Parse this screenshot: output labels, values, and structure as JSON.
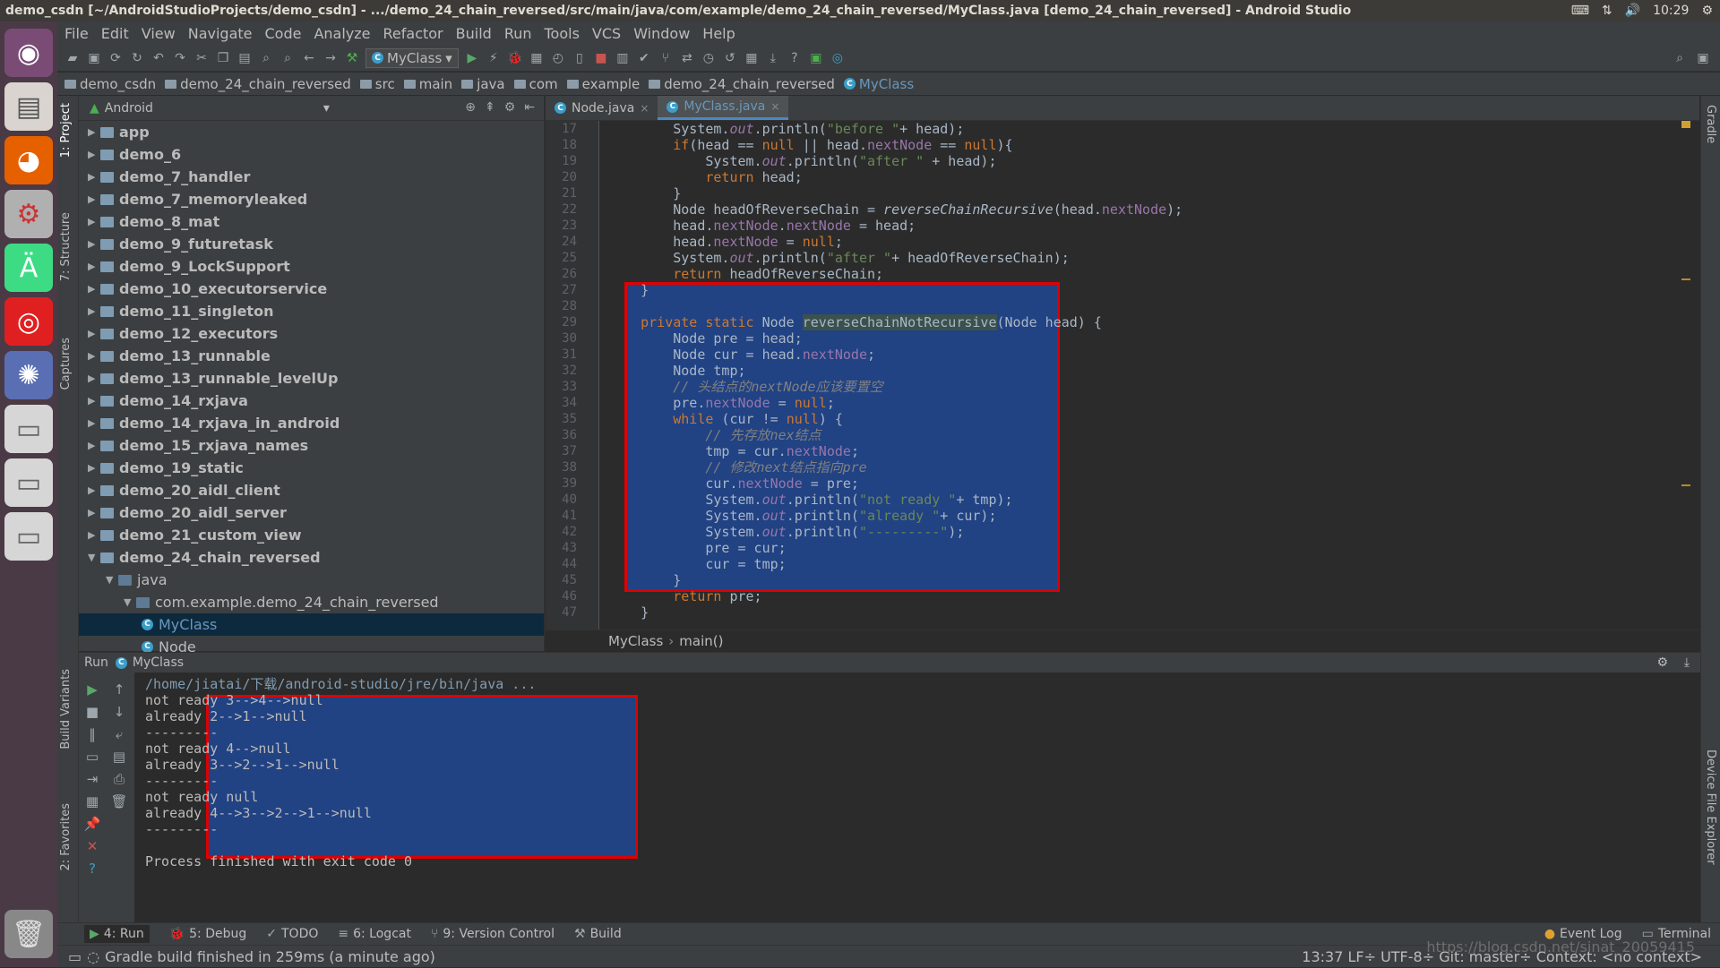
{
  "titlebar": {
    "text": "demo_csdn [~/AndroidStudioProjects/demo_csdn] - .../demo_24_chain_reversed/src/main/java/com/example/demo_24_chain_reversed/MyClass.java [demo_24_chain_reversed] - Android Studio",
    "time": "10:29"
  },
  "menu": [
    "File",
    "Edit",
    "View",
    "Navigate",
    "Code",
    "Analyze",
    "Refactor",
    "Build",
    "Run",
    "Tools",
    "VCS",
    "Window",
    "Help"
  ],
  "toolbar": {
    "run_config": "MyClass"
  },
  "breadcrumb": [
    "demo_csdn",
    "demo_24_chain_reversed",
    "src",
    "main",
    "java",
    "com",
    "example",
    "demo_24_chain_reversed",
    "MyClass"
  ],
  "project": {
    "view": "Android",
    "items": [
      {
        "label": "app",
        "depth": 0,
        "open": false
      },
      {
        "label": "demo_6",
        "depth": 0,
        "open": false
      },
      {
        "label": "demo_7_handler",
        "depth": 0,
        "open": false
      },
      {
        "label": "demo_7_memoryleaked",
        "depth": 0,
        "open": false
      },
      {
        "label": "demo_8_mat",
        "depth": 0,
        "open": false
      },
      {
        "label": "demo_9_futuretask",
        "depth": 0,
        "open": false
      },
      {
        "label": "demo_9_LockSupport",
        "depth": 0,
        "open": false
      },
      {
        "label": "demo_10_executorservice",
        "depth": 0,
        "open": false
      },
      {
        "label": "demo_11_singleton",
        "depth": 0,
        "open": false
      },
      {
        "label": "demo_12_executors",
        "depth": 0,
        "open": false
      },
      {
        "label": "demo_13_runnable",
        "depth": 0,
        "open": false
      },
      {
        "label": "demo_13_runnable_levelUp",
        "depth": 0,
        "open": false
      },
      {
        "label": "demo_14_rxjava",
        "depth": 0,
        "open": false
      },
      {
        "label": "demo_14_rxjava_in_android",
        "depth": 0,
        "open": false
      },
      {
        "label": "demo_15_rxjava_names",
        "depth": 0,
        "open": false
      },
      {
        "label": "demo_19_static",
        "depth": 0,
        "open": false
      },
      {
        "label": "demo_20_aidl_client",
        "depth": 0,
        "open": false
      },
      {
        "label": "demo_20_aidl_server",
        "depth": 0,
        "open": false
      },
      {
        "label": "demo_21_custom_view",
        "depth": 0,
        "open": false
      },
      {
        "label": "demo_24_chain_reversed",
        "depth": 0,
        "open": true
      },
      {
        "label": "java",
        "depth": 1,
        "open": true
      },
      {
        "label": "com.example.demo_24_chain_reversed",
        "depth": 2,
        "open": true
      },
      {
        "label": "MyClass",
        "depth": 3,
        "file": true,
        "selected": true
      },
      {
        "label": "Node",
        "depth": 3,
        "file": true
      }
    ]
  },
  "tabs": [
    {
      "label": "Node.java",
      "active": false
    },
    {
      "label": "MyClass.java",
      "active": true
    }
  ],
  "line_numbers": [
    "17",
    "18",
    "19",
    "20",
    "21",
    "22",
    "23",
    "24",
    "25",
    "26",
    "27",
    "28",
    "29",
    "30",
    "31",
    "32",
    "33",
    "34",
    "35",
    "36",
    "37",
    "38",
    "39",
    "40",
    "41",
    "42",
    "43",
    "44",
    "45",
    "46",
    "47"
  ],
  "code_lines": [
    [
      [
        "        System.",
        "p"
      ],
      [
        "out",
        "st"
      ],
      [
        ".println(",
        "p"
      ],
      [
        "\"before \"",
        "str"
      ],
      [
        "+ head);",
        "p"
      ]
    ],
    [
      [
        "        ",
        "p"
      ],
      [
        "if",
        "kw"
      ],
      [
        "(head == ",
        "p"
      ],
      [
        "null",
        "kw"
      ],
      [
        " || head.",
        "p"
      ],
      [
        "nextNode",
        "fld"
      ],
      [
        " == ",
        "p"
      ],
      [
        "null",
        "kw"
      ],
      [
        "){",
        "p"
      ]
    ],
    [
      [
        "            System.",
        "p"
      ],
      [
        "out",
        "st"
      ],
      [
        ".println(",
        "p"
      ],
      [
        "\"after \"",
        "str"
      ],
      [
        " + head);",
        "p"
      ]
    ],
    [
      [
        "            ",
        "p"
      ],
      [
        "return",
        "kw"
      ],
      [
        " head;",
        "p"
      ]
    ],
    [
      [
        "        }",
        "p"
      ]
    ],
    [
      [
        "        Node headOfReverseChain = ",
        "p"
      ],
      [
        "reverseChainRecursive",
        "it"
      ],
      [
        "(head.",
        "p"
      ],
      [
        "nextNode",
        "fld"
      ],
      [
        ");",
        "p"
      ]
    ],
    [
      [
        "        head.",
        "p"
      ],
      [
        "nextNode",
        "fld"
      ],
      [
        ".",
        "p"
      ],
      [
        "nextNode",
        "fld"
      ],
      [
        " = head;",
        "p"
      ]
    ],
    [
      [
        "        head.",
        "p"
      ],
      [
        "nextNode",
        "fld"
      ],
      [
        " = ",
        "p"
      ],
      [
        "null",
        "kw"
      ],
      [
        ";",
        "p"
      ]
    ],
    [
      [
        "        System.",
        "p"
      ],
      [
        "out",
        "st"
      ],
      [
        ".println(",
        "p"
      ],
      [
        "\"after \"",
        "str"
      ],
      [
        "+ headOfReverseChain);",
        "p"
      ]
    ],
    [
      [
        "        ",
        "p"
      ],
      [
        "return",
        "kw"
      ],
      [
        " headOfReverseChain;",
        "p"
      ]
    ],
    [
      [
        "    }",
        "p"
      ]
    ],
    [
      [
        "",
        "p"
      ]
    ],
    [
      [
        "    ",
        "p"
      ],
      [
        "private static",
        "kw"
      ],
      [
        " Node ",
        "p"
      ],
      [
        "reverseChainNotRecursive",
        "p"
      ],
      [
        "(Node head) {",
        "p"
      ]
    ],
    [
      [
        "        Node pre = head;",
        "p"
      ]
    ],
    [
      [
        "        Node cur = head.",
        "p"
      ],
      [
        "nextNode",
        "fld"
      ],
      [
        ";",
        "p"
      ]
    ],
    [
      [
        "        Node tmp;",
        "p"
      ]
    ],
    [
      [
        "        // 头结点的nextNode应该要置空",
        "cm"
      ]
    ],
    [
      [
        "        pre.",
        "p"
      ],
      [
        "nextNode",
        "fld"
      ],
      [
        " = ",
        "p"
      ],
      [
        "null",
        "kw"
      ],
      [
        ";",
        "p"
      ]
    ],
    [
      [
        "        ",
        "p"
      ],
      [
        "while",
        "kw"
      ],
      [
        " (cur != ",
        "p"
      ],
      [
        "null",
        "kw"
      ],
      [
        ") {",
        "p"
      ]
    ],
    [
      [
        "            // 先存放nex结点",
        "cm"
      ]
    ],
    [
      [
        "            tmp = cur.",
        "p"
      ],
      [
        "nextNode",
        "fld"
      ],
      [
        ";",
        "p"
      ]
    ],
    [
      [
        "            // 修改next结点指向pre",
        "cm"
      ]
    ],
    [
      [
        "            cur.",
        "p"
      ],
      [
        "nextNode",
        "fld"
      ],
      [
        " = pre;",
        "p"
      ]
    ],
    [
      [
        "            System.",
        "p"
      ],
      [
        "out",
        "st"
      ],
      [
        ".println(",
        "p"
      ],
      [
        "\"not ready \"",
        "str"
      ],
      [
        "+ tmp);",
        "p"
      ]
    ],
    [
      [
        "            System.",
        "p"
      ],
      [
        "out",
        "st"
      ],
      [
        ".println(",
        "p"
      ],
      [
        "\"already \"",
        "str"
      ],
      [
        "+ cur);",
        "p"
      ]
    ],
    [
      [
        "            System.",
        "p"
      ],
      [
        "out",
        "st"
      ],
      [
        ".println(",
        "p"
      ],
      [
        "\"---------\"",
        "str"
      ],
      [
        ");",
        "p"
      ]
    ],
    [
      [
        "            pre = cur;",
        "p"
      ]
    ],
    [
      [
        "            cur = tmp;",
        "p"
      ]
    ],
    [
      [
        "        }",
        "p"
      ]
    ],
    [
      [
        "        ",
        "p"
      ],
      [
        "return",
        "kw"
      ],
      [
        " pre;",
        "p"
      ]
    ],
    [
      [
        "    }",
        "p"
      ]
    ]
  ],
  "editor_breadcrumb": [
    "MyClass",
    "main()"
  ],
  "run": {
    "title": "Run",
    "config": "MyClass",
    "output": [
      "/home/jiatai/下载/android-studio/jre/bin/java ...",
      "not ready 3-->4-->null",
      "already 2-->1-->null",
      "---------",
      "not ready 4-->null",
      "already 3-->2-->1-->null",
      "---------",
      "not ready null",
      "already 4-->3-->2-->1-->null",
      "---------",
      "",
      "Process finished with exit code 0"
    ]
  },
  "bottom_tabs": [
    "4: Run",
    "5: Debug",
    "TODO",
    "6: Logcat",
    "9: Version Control",
    "Build"
  ],
  "bottom_right_tabs": [
    "Event Log",
    "Terminal"
  ],
  "side_tabs": {
    "left": [
      "1: Project",
      "7: Structure",
      "Captures",
      "Build Variants",
      "2: Favorites"
    ],
    "right": [
      "Gradle",
      "Device File Explorer"
    ]
  },
  "status": {
    "message": "Gradle build finished in 259ms (a minute ago)",
    "right": "13:37  LF÷  UTF-8÷  Git: master÷  Context: <no context>"
  },
  "watermark": "https://blog.csdn.net/sinat_20059415"
}
